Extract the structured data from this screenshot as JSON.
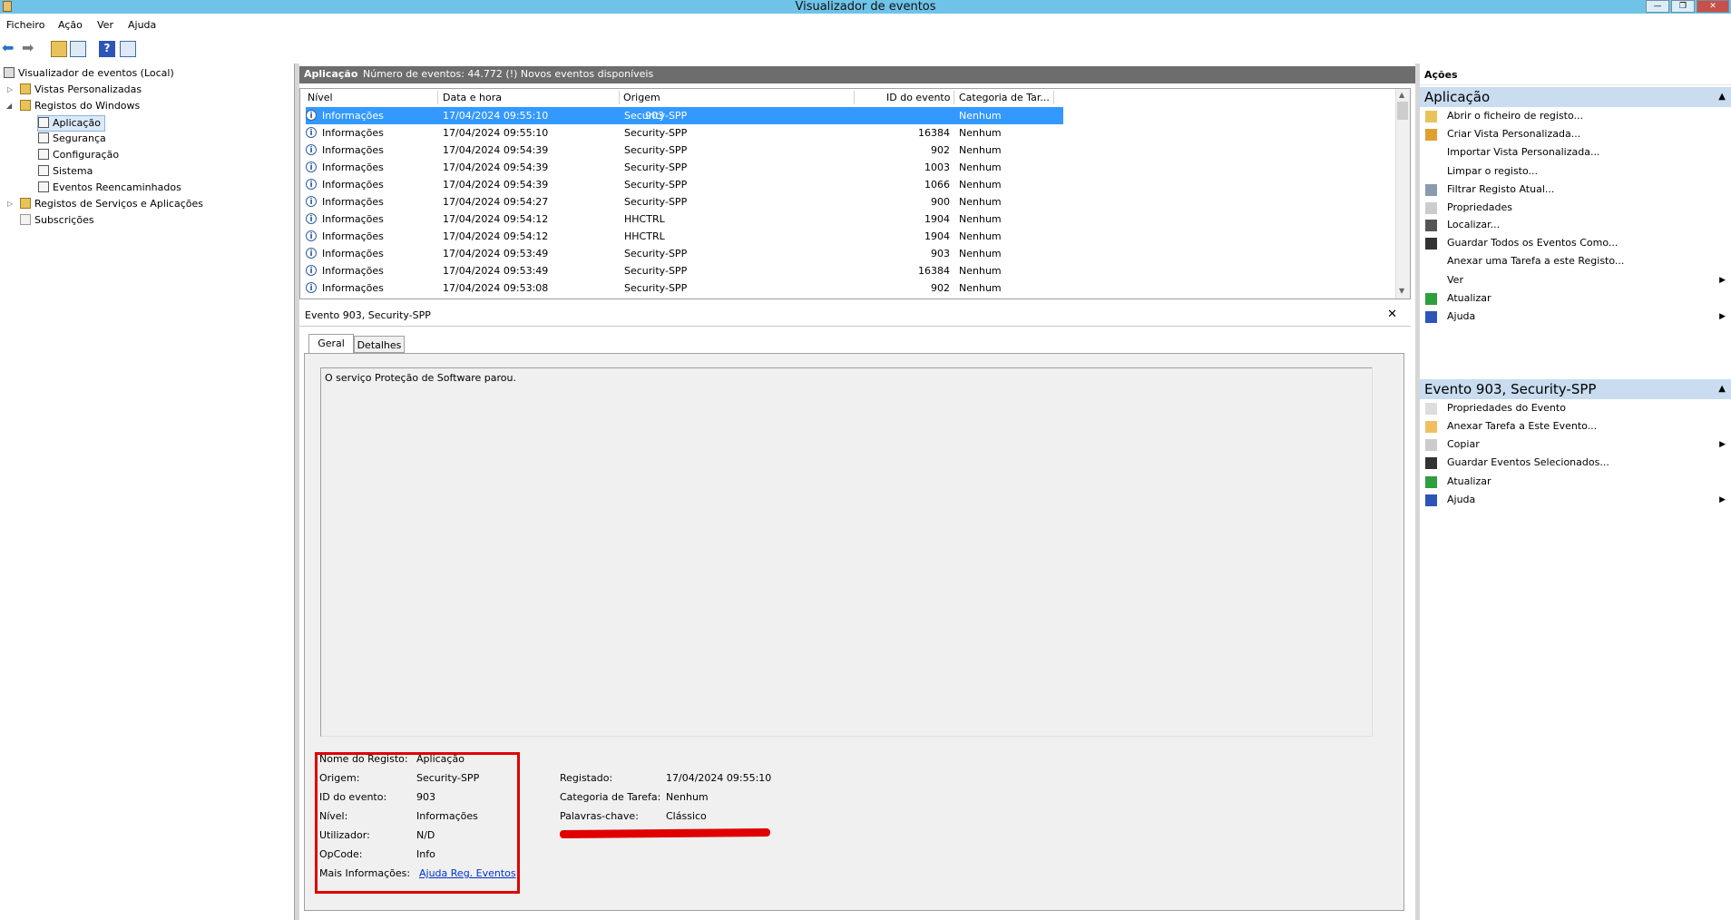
{
  "window": {
    "title": "Visualizador de eventos"
  },
  "menu": [
    "Ficheiro",
    "Ação",
    "Ver",
    "Ajuda"
  ],
  "tree": {
    "root": "Visualizador de eventos (Local)",
    "custom_views": "Vistas Personalizadas",
    "windows_logs": "Registos do Windows",
    "application": "Aplicação",
    "security": "Segurança",
    "setup": "Configuração",
    "system": "Sistema",
    "forwarded": "Eventos Reencaminhados",
    "apps_services": "Registos de Serviços e Aplicações",
    "subscriptions": "Subscrições"
  },
  "center": {
    "log_name": "Aplicação",
    "event_count": "Número de eventos: 44.772 (!) Novos eventos disponíveis"
  },
  "grid": {
    "columns": [
      "Nível",
      "Data e hora",
      "Origem",
      "ID do evento",
      "Categoria de Tar..."
    ],
    "rows": [
      [
        "Informações",
        "17/04/2024 09:55:10",
        "Security-SPP",
        "903",
        "Nenhum"
      ],
      [
        "Informações",
        "17/04/2024 09:55:10",
        "Security-SPP",
        "16384",
        "Nenhum"
      ],
      [
        "Informações",
        "17/04/2024 09:54:39",
        "Security-SPP",
        "902",
        "Nenhum"
      ],
      [
        "Informações",
        "17/04/2024 09:54:39",
        "Security-SPP",
        "1003",
        "Nenhum"
      ],
      [
        "Informações",
        "17/04/2024 09:54:39",
        "Security-SPP",
        "1066",
        "Nenhum"
      ],
      [
        "Informações",
        "17/04/2024 09:54:27",
        "Security-SPP",
        "900",
        "Nenhum"
      ],
      [
        "Informações",
        "17/04/2024 09:54:12",
        "HHCTRL",
        "1904",
        "Nenhum"
      ],
      [
        "Informações",
        "17/04/2024 09:54:12",
        "HHCTRL",
        "1904",
        "Nenhum"
      ],
      [
        "Informações",
        "17/04/2024 09:53:49",
        "Security-SPP",
        "903",
        "Nenhum"
      ],
      [
        "Informações",
        "17/04/2024 09:53:49",
        "Security-SPP",
        "16384",
        "Nenhum"
      ],
      [
        "Informações",
        "17/04/2024 09:53:08",
        "Security-SPP",
        "902",
        "Nenhum"
      ]
    ],
    "selected_row": 0
  },
  "detail": {
    "title": "Evento 903, Security-SPP",
    "tabs": [
      "Geral",
      "Detalhes"
    ],
    "message": "O serviço Proteção de Software parou.",
    "fields_left": [
      {
        "label": "Nome do Registo:",
        "value": "Aplicação"
      },
      {
        "label": "Origem:",
        "value": "Security-SPP"
      },
      {
        "label": "ID do evento:",
        "value": "903"
      },
      {
        "label": "Nível:",
        "value": "Informações"
      },
      {
        "label": "Utilizador:",
        "value": "N/D"
      },
      {
        "label": "OpCode:",
        "value": "Info"
      },
      {
        "label": "Mais Informações:",
        "value": "Ajuda Reg. Eventos"
      }
    ],
    "fields_right": [
      {
        "label": "Registado:",
        "value": "17/04/2024 09:55:10"
      },
      {
        "label": "Categoria de Tarefa:",
        "value": "Nenhum"
      },
      {
        "label": "Palavras-chave:",
        "value": "Clássico"
      }
    ]
  },
  "actions": {
    "title": "Ações",
    "section1": {
      "title": "Aplicação",
      "items": [
        "Abrir o ficheiro de registo...",
        "Criar Vista Personalizada...",
        "Importar Vista Personalizada...",
        "Limpar o registo...",
        "Filtrar Registo Atual...",
        "Propriedades",
        "Localizar...",
        "Guardar Todos os Eventos Como...",
        "Anexar uma Tarefa a este Registo...",
        "Ver",
        "Atualizar",
        "Ajuda"
      ]
    },
    "section2": {
      "title": "Evento 903, Security-SPP",
      "items": [
        "Propriedades do Evento",
        "Anexar Tarefa a Este Evento...",
        "Copiar",
        "Guardar Eventos Selecionados...",
        "Atualizar",
        "Ajuda"
      ]
    }
  },
  "colors": {
    "selection": "#3399ff",
    "annotation": "#e00000",
    "header_bg": "#6d6d6d",
    "section_bg": "#c9dcf0"
  }
}
